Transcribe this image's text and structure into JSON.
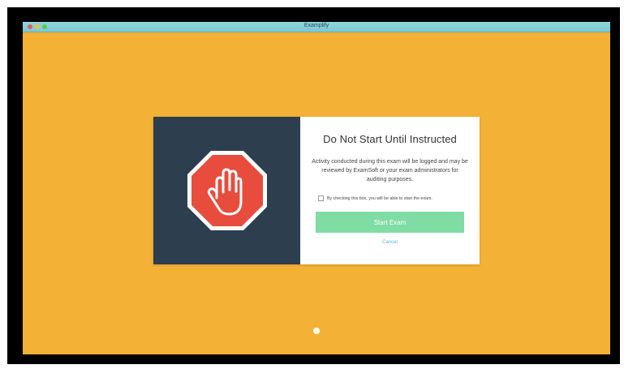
{
  "window": {
    "title": "Examplify",
    "background_color": "#f3b136"
  },
  "dialog": {
    "icon": "stop-hand-icon",
    "title": "Do Not Start Until Instructed",
    "body": "Activity conducted during this exam will be logged and may be reviewed by ExamSoft or your exam administrators for auditing purposes.",
    "checkbox_label": "By checking this box, you will be able to start the exam.",
    "checkbox_checked": false,
    "start_button_label": "Start Exam",
    "cancel_label": "Cancel",
    "left_panel_color": "#2d3e4e",
    "stop_sign_color": "#e74c3c",
    "button_color": "#7fdca4",
    "link_color": "#5ab2d8"
  }
}
